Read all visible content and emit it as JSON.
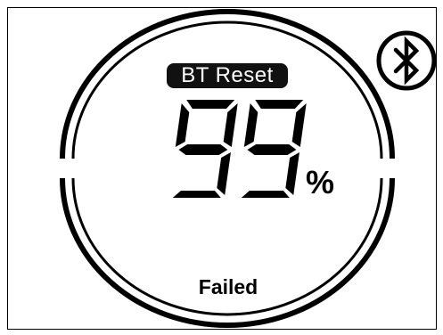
{
  "display": {
    "mode_label": "BT Reset",
    "digits": "99",
    "unit": "%",
    "status": "Failed",
    "progress_percent": 99
  },
  "icons": {
    "bluetooth": "bluetooth-icon"
  },
  "colors": {
    "foreground": "#000000",
    "background": "#ffffff",
    "label_fill": "#111111",
    "label_text": "#ffffff"
  }
}
